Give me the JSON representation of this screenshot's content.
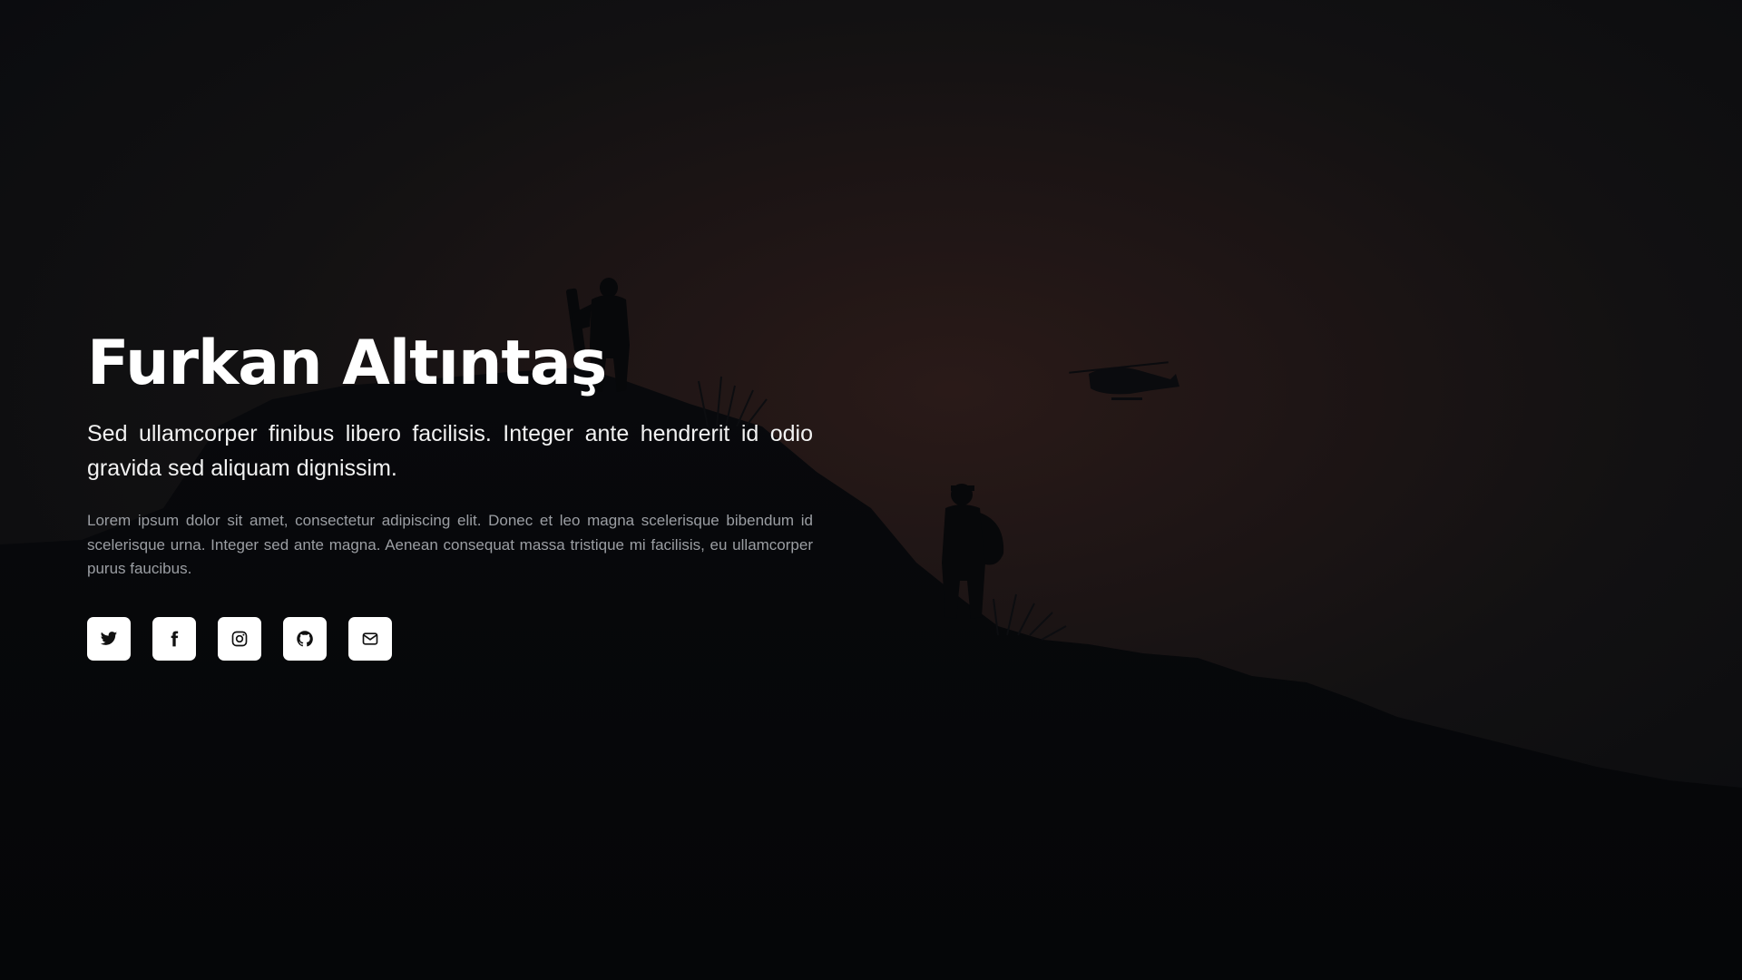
{
  "hero": {
    "name": "Furkan Altıntaş",
    "subtitle": "Sed ullamcorper finibus libero facilisis. Integer ante hendrerit id odio gravida sed aliquam dignissim.",
    "description": "Lorem ipsum dolor sit amet, consectetur adipiscing elit. Donec et leo magna scelerisque bibendum id scelerisque urna. Integer sed ante magna. Aenean consequat massa tristique mi facilisis, eu ullamcorper purus faucibus."
  },
  "social_links": [
    {
      "icon": "twitter-icon"
    },
    {
      "icon": "facebook-icon"
    },
    {
      "icon": "instagram-icon"
    },
    {
      "icon": "github-icon"
    },
    {
      "icon": "mail-icon"
    }
  ],
  "colors": {
    "text_primary": "#ffffff",
    "text_muted": "#9b9ea3",
    "button_bg": "#ffffff",
    "background": "#07090c"
  }
}
